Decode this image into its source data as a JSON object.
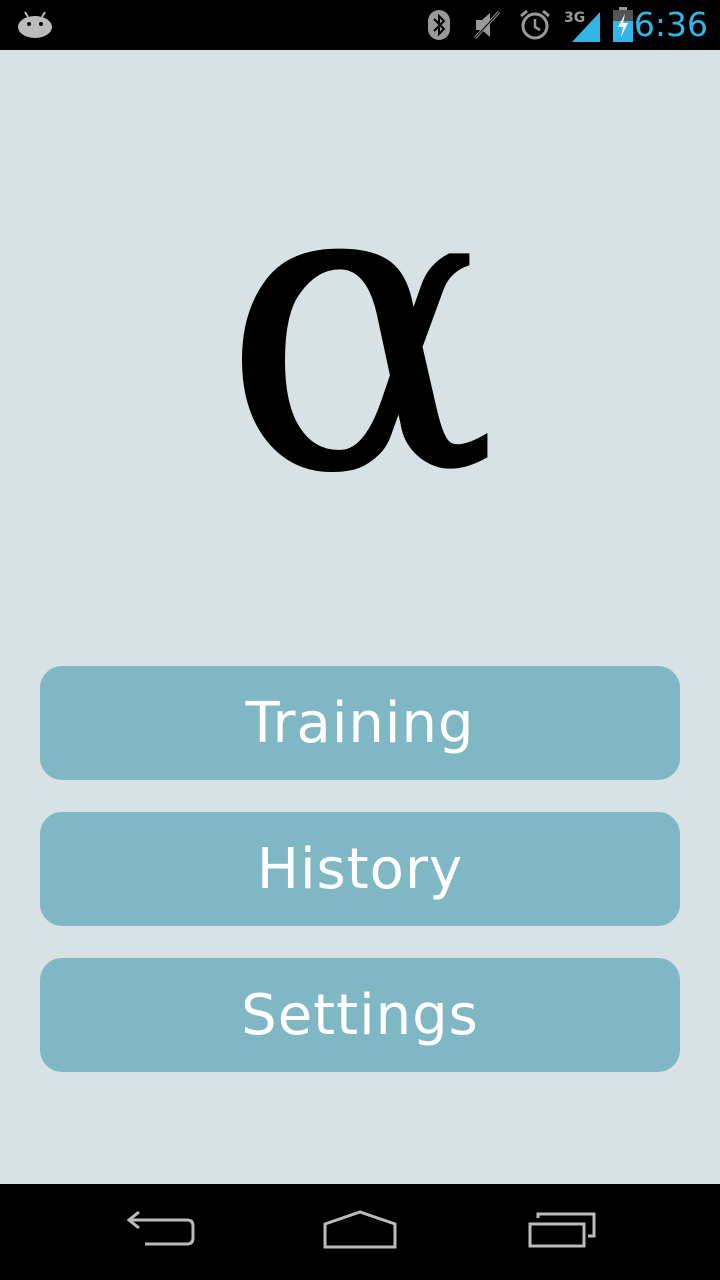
{
  "status_bar": {
    "time": "6:36",
    "network": "3G",
    "icons": [
      "android-notification-icon",
      "bluetooth-icon",
      "mute-icon",
      "alarm-icon",
      "signal-icon",
      "battery-charging-icon"
    ],
    "accent_color": "#33b5e5"
  },
  "logo": {
    "glyph": "α"
  },
  "menu": {
    "training_label": "Training",
    "history_label": "History",
    "settings_label": "Settings",
    "button_color": "#7fb8c4",
    "background_color": "#d8e2e4"
  },
  "nav_bar": {
    "icons": [
      "back-icon",
      "home-icon",
      "recent-apps-icon"
    ]
  }
}
